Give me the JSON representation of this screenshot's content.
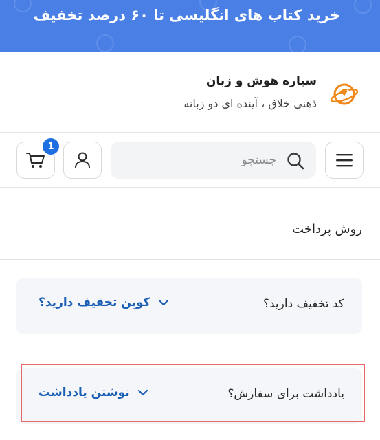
{
  "promo": {
    "text": "خرید کتاب های انگلیسی تا ۶۰ درصد تخفیف",
    "bg": "#4a80e6"
  },
  "brand": {
    "name": "سیاره هوش و زبان",
    "tagline": "ذهنی خلاق ، آینده ای دو زبانه"
  },
  "toolbar": {
    "menu_icon": "hamburger-icon",
    "search_placeholder": "جستجو",
    "search_icon": "search-icon",
    "user_icon": "user-icon",
    "cart_icon": "cart-icon",
    "cart_count": "1"
  },
  "checkout": {
    "section_title": "روش پرداخت"
  },
  "discount": {
    "label": "کد تخفیف دارید؟",
    "link": "کوپن تخفیف دارید؟"
  },
  "note": {
    "label": "یادداشت برای سفارش؟",
    "link": "نوشتن یادداشت"
  },
  "colors": {
    "accent": "#1e6fe0",
    "link": "#1a5fb4",
    "highlight": "#e46a6a"
  }
}
